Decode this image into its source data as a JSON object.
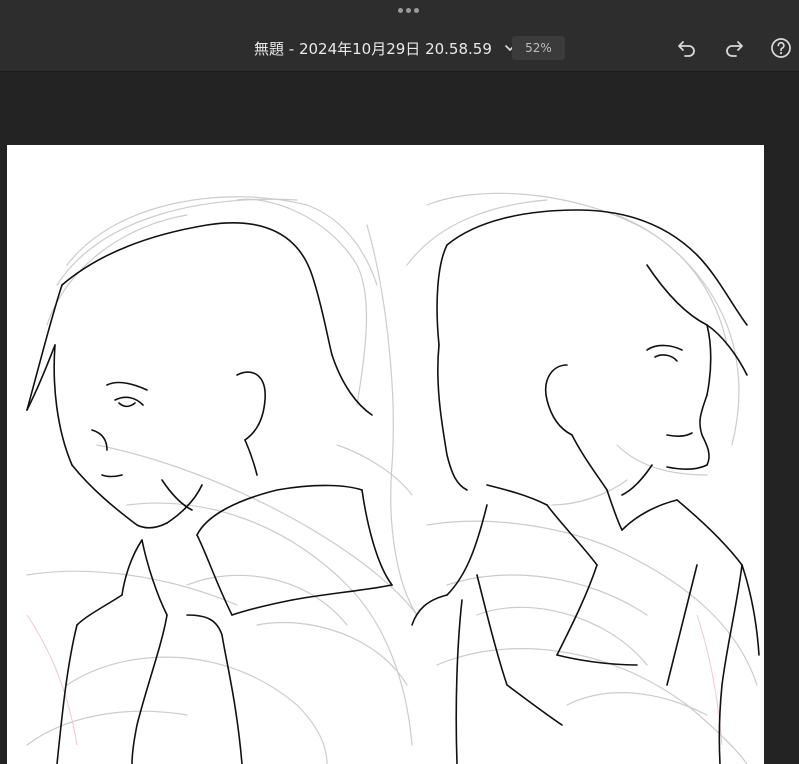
{
  "document": {
    "title": "無題 - 2024年10月29日 20.58.59",
    "zoom": "52%"
  },
  "icons": {
    "grip": "more-horizontal-icon",
    "title_menu": "chevron-down-icon",
    "undo": "undo-icon",
    "redo": "redo-icon",
    "help": "help-icon"
  },
  "colors": {
    "toolbar_bg": "#2d2d2d",
    "workspace_bg": "#232323",
    "paper_bg": "#ffffff",
    "ink": "#111111",
    "sketch": "#c9c9c9"
  }
}
